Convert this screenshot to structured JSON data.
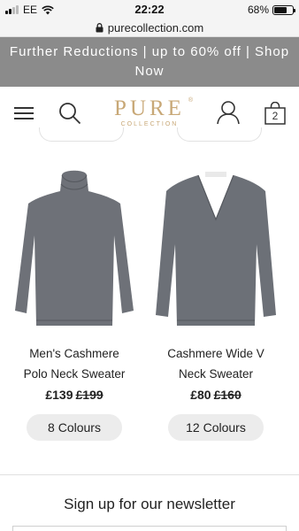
{
  "status_bar": {
    "carrier": "EE",
    "time": "22:22",
    "battery": "68%",
    "battery_level": 0.68
  },
  "browser": {
    "url": "purecollection.com"
  },
  "promo": {
    "text": "Further Reductions | up to 60% off | Shop Now"
  },
  "header": {
    "logo_main": "PURE",
    "logo_sub": "COLLECTION",
    "logo_mark": "®",
    "bag_count": "2"
  },
  "products": [
    {
      "name_line1": "Men's Cashmere",
      "name_line2": "Polo Neck Sweater",
      "price": "£139",
      "was_price": "£199",
      "colours": "8 Colours",
      "color": "#6e7178"
    },
    {
      "name_line1": "Cashmere Wide V",
      "name_line2": "Neck Sweater",
      "price": "£80",
      "was_price": "£160",
      "colours": "12 Colours",
      "color": "#6c7077"
    }
  ],
  "newsletter": {
    "heading": "Sign up for our newsletter"
  },
  "colors": {
    "promo_bg": "#8b8b8b",
    "logo_gold": "#c8a877",
    "pill_bg": "#ececec"
  },
  "icons": [
    "signal-icon",
    "wifi-icon",
    "battery-icon",
    "lock-icon",
    "menu-icon",
    "search-icon",
    "account-icon",
    "bag-icon"
  ]
}
